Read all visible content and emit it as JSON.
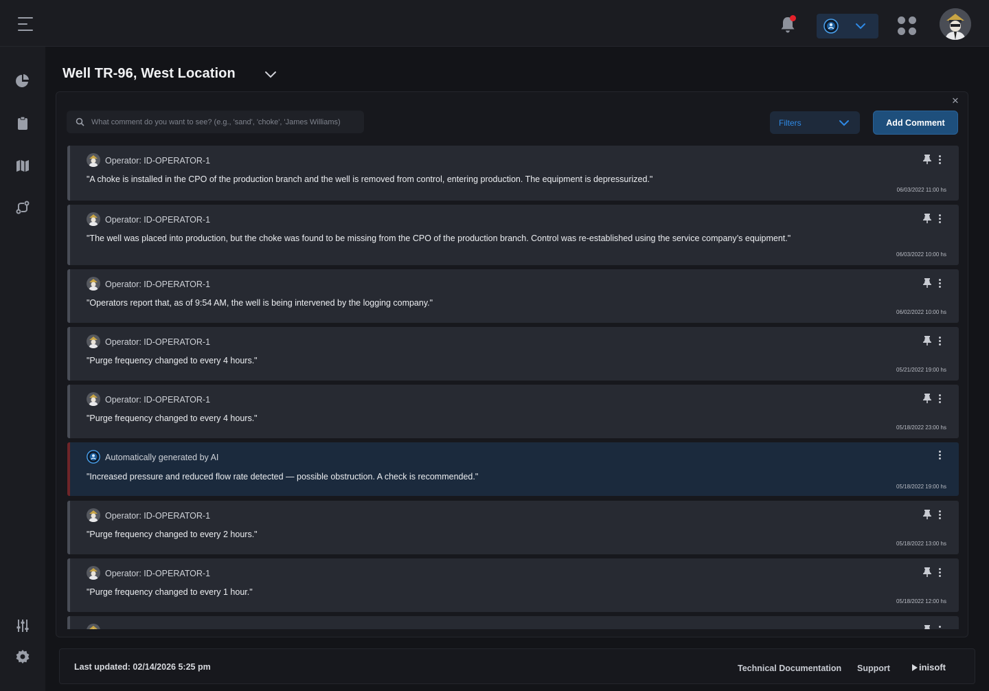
{
  "header": {
    "title": "Well TR-96, West Location"
  },
  "panel": {
    "search_placeholder": "What comment do you want to see? (e.g., 'sand', 'choke', 'James Williams)",
    "filters_label": "Filters",
    "add_comment_label": "Add Comment",
    "close_label": "✕"
  },
  "comments": [
    {
      "author": "Operator: ID-OPERATOR-1",
      "text": "\"A choke is installed in the CPO of the production branch and the well is removed from control, entering production. The equipment is depressurized.\"",
      "timestamp": "06/03/2022 11:00 hs"
    },
    {
      "author": "Operator: ID-OPERATOR-1",
      "text": "\"The well was placed into production, but the choke was found to be missing from the CPO of the production branch. Control was re-established using the service company’s equipment.\"",
      "timestamp": "06/03/2022 10:00 hs"
    },
    {
      "author": "Operator: ID-OPERATOR-1",
      "text": "\"Operators report that, as of 9:54 AM, the well is being intervened by the logging company.\"",
      "timestamp": "06/02/2022 10:00 hs"
    },
    {
      "author": "Operator: ID-OPERATOR-1",
      "text": "\"Purge frequency changed to every 4 hours.\"",
      "timestamp": "05/21/2022 19:00 hs"
    },
    {
      "author": "Operator: ID-OPERATOR-1",
      "text": "\"Purge frequency changed to every 4 hours.\"",
      "timestamp": "05/18/2022 23:00 hs"
    },
    {
      "author": "Automatically generated by AI",
      "text": "\"Increased pressure and reduced flow rate detected — possible obstruction. A check is recommended.\"",
      "timestamp": "05/18/2022 19:00 hs"
    },
    {
      "author": "Operator: ID-OPERATOR-1",
      "text": "\"Purge frequency changed to every 2 hours.\"",
      "timestamp": "05/18/2022  13:00 hs"
    },
    {
      "author": "Operator: ID-OPERATOR-1",
      "text": "\"Purge frequency changed to every 1 hour.\"",
      "timestamp": "05/18/2022  12:00 hs"
    }
  ],
  "footer": {
    "last_updated": "Last updated: 02/14/2026 5:25 pm",
    "technical_docs": "Technical Documentation",
    "support": "Support",
    "brand": "inisoft"
  },
  "colors": {
    "accent_blue": "#2f8ae6",
    "primary_button": "#1e4f7c",
    "notification_dot": "#e5212a",
    "ai_card_bg": "#1b2a3d",
    "ai_card_border": "#6e2529"
  }
}
